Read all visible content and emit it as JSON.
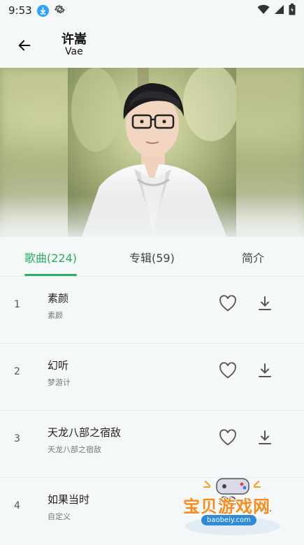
{
  "status_bar": {
    "time": "9:53",
    "icons": [
      "download-badge-icon",
      "gear-icon",
      "wifi-icon",
      "signal-icon",
      "battery-icon"
    ]
  },
  "header": {
    "artist_name": "许嵩",
    "artist_alias": "Vae"
  },
  "tabs": [
    {
      "label": "歌曲(224)",
      "active": true
    },
    {
      "label": "专辑(59)",
      "active": false
    },
    {
      "label": "简介",
      "active": false
    }
  ],
  "songs": [
    {
      "index": "1",
      "title": "素颜",
      "album": "素颜"
    },
    {
      "index": "2",
      "title": "幻听",
      "album": "梦游计"
    },
    {
      "index": "3",
      "title": "天龙八部之宿敌",
      "album": "天龙八部之宿敌"
    },
    {
      "index": "4",
      "title": "如果当时",
      "album": "自定义"
    }
  ],
  "watermark": {
    "text": "宝贝游戏网",
    "subtext": "baobeiy.com"
  },
  "colors": {
    "accent": "#27ae60",
    "background": "#f4f8f8"
  }
}
